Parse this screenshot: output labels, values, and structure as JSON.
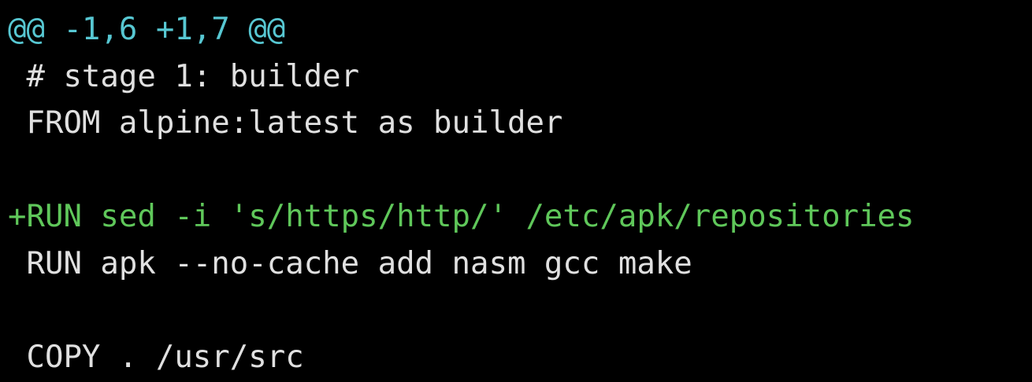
{
  "window": {
    "background": "#000000"
  },
  "colors": {
    "hunk_header": "#57c7d2",
    "context": "#e0e0e0",
    "added": "#5fc75a"
  },
  "diff": {
    "lines": [
      {
        "type": "hunk-header",
        "text": "@@ -1,6 +1,7 @@"
      },
      {
        "type": "context",
        "text": " # stage 1: builder"
      },
      {
        "type": "context",
        "text": " FROM alpine:latest as builder"
      },
      {
        "type": "context",
        "text": " "
      },
      {
        "type": "added",
        "text": "+RUN sed -i 's/https/http/' /etc/apk/repositories"
      },
      {
        "type": "context",
        "text": " RUN apk --no-cache add nasm gcc make"
      },
      {
        "type": "context",
        "text": " "
      },
      {
        "type": "context",
        "text": " COPY . /usr/src"
      }
    ]
  }
}
